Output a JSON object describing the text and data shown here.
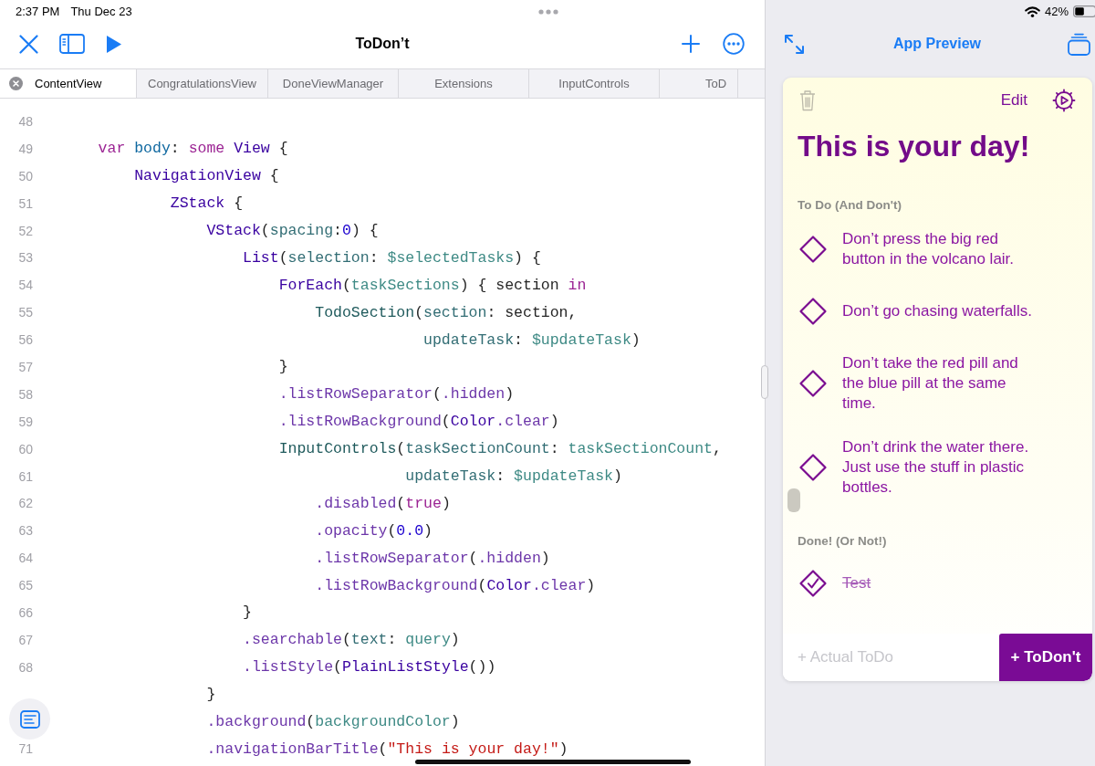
{
  "status_bar": {
    "time": "2:37 PM",
    "date": "Thu Dec 23",
    "battery": "42%"
  },
  "editor": {
    "title": "ToDon’t",
    "tabs": [
      {
        "label": "ContentView",
        "selected": true
      },
      {
        "label": "CongratulationsView",
        "selected": false
      },
      {
        "label": "DoneViewManager",
        "selected": false
      },
      {
        "label": "Extensions",
        "selected": false
      },
      {
        "label": "InputControls",
        "selected": false
      },
      {
        "label": "ToD",
        "selected": false
      }
    ],
    "code_lines": [
      {
        "number": "48"
      },
      {
        "number": "49",
        "tokens": [
          {
            "kind": "keyword",
            "text": "    var"
          },
          {
            "kind": "declaration",
            "text": " body"
          },
          {
            "kind": "plain",
            "text": ": "
          },
          {
            "kind": "keyword",
            "text": "some"
          },
          {
            "kind": "type",
            "text": " View"
          },
          {
            "kind": "plain",
            "text": " {"
          }
        ]
      },
      {
        "number": "50",
        "tokens": [
          {
            "kind": "type",
            "text": "        NavigationView"
          },
          {
            "kind": "plain",
            "text": " {"
          }
        ]
      },
      {
        "number": "51",
        "tokens": [
          {
            "kind": "type",
            "text": "            ZStack"
          },
          {
            "kind": "plain",
            "text": " {"
          }
        ]
      },
      {
        "number": "52",
        "tokens": [
          {
            "kind": "type",
            "text": "                VStack"
          },
          {
            "kind": "plain",
            "text": "("
          },
          {
            "kind": "label",
            "text": "spacing"
          },
          {
            "kind": "plain",
            "text": ":"
          },
          {
            "kind": "number",
            "text": "0"
          },
          {
            "kind": "plain",
            "text": ") {"
          }
        ]
      },
      {
        "number": "53",
        "tokens": [
          {
            "kind": "type",
            "text": "                    List"
          },
          {
            "kind": "plain",
            "text": "("
          },
          {
            "kind": "label",
            "text": "selection"
          },
          {
            "kind": "plain",
            "text": ": "
          },
          {
            "kind": "project",
            "text": "$selectedTasks"
          },
          {
            "kind": "plain",
            "text": ") {"
          }
        ]
      },
      {
        "number": "54",
        "tokens": [
          {
            "kind": "type",
            "text": "                        ForEach"
          },
          {
            "kind": "plain",
            "text": "("
          },
          {
            "kind": "project",
            "text": "taskSections"
          },
          {
            "kind": "plain",
            "text": ") { section "
          },
          {
            "kind": "keyword",
            "text": "in"
          }
        ]
      },
      {
        "number": "55",
        "tokens": [
          {
            "kind": "project_type",
            "text": "                            TodoSection"
          },
          {
            "kind": "plain",
            "text": "("
          },
          {
            "kind": "label",
            "text": "section"
          },
          {
            "kind": "plain",
            "text": ": section,"
          }
        ]
      },
      {
        "number": "56",
        "tokens": [
          {
            "kind": "label",
            "text": "                                        updateTask"
          },
          {
            "kind": "plain",
            "text": ": "
          },
          {
            "kind": "project",
            "text": "$updateTask"
          },
          {
            "kind": "plain",
            "text": ")"
          }
        ]
      },
      {
        "number": "57",
        "tokens": [
          {
            "kind": "plain",
            "text": "                        }"
          }
        ]
      },
      {
        "number": "58",
        "tokens": [
          {
            "kind": "method",
            "text": "                        .listRowSeparator"
          },
          {
            "kind": "plain",
            "text": "("
          },
          {
            "kind": "method",
            "text": ".hidden"
          },
          {
            "kind": "plain",
            "text": ")"
          }
        ]
      },
      {
        "number": "59",
        "tokens": [
          {
            "kind": "method",
            "text": "                        .listRowBackground"
          },
          {
            "kind": "plain",
            "text": "("
          },
          {
            "kind": "type",
            "text": "Color"
          },
          {
            "kind": "method",
            "text": ".clear"
          },
          {
            "kind": "plain",
            "text": ")"
          }
        ]
      },
      {
        "number": "60",
        "tokens": [
          {
            "kind": "project_type",
            "text": "                        InputControls"
          },
          {
            "kind": "plain",
            "text": "("
          },
          {
            "kind": "label",
            "text": "taskSectionCount"
          },
          {
            "kind": "plain",
            "text": ": "
          },
          {
            "kind": "project",
            "text": "taskSectionCount"
          },
          {
            "kind": "plain",
            "text": ","
          }
        ]
      },
      {
        "number": "61",
        "tokens": [
          {
            "kind": "label",
            "text": "                                      updateTask"
          },
          {
            "kind": "plain",
            "text": ": "
          },
          {
            "kind": "project",
            "text": "$updateTask"
          },
          {
            "kind": "plain",
            "text": ")"
          }
        ]
      },
      {
        "number": "62",
        "tokens": [
          {
            "kind": "method",
            "text": "                            .disabled"
          },
          {
            "kind": "plain",
            "text": "("
          },
          {
            "kind": "keyword",
            "text": "true"
          },
          {
            "kind": "plain",
            "text": ")"
          }
        ]
      },
      {
        "number": "63",
        "tokens": [
          {
            "kind": "method",
            "text": "                            .opacity"
          },
          {
            "kind": "plain",
            "text": "("
          },
          {
            "kind": "number",
            "text": "0.0"
          },
          {
            "kind": "plain",
            "text": ")"
          }
        ]
      },
      {
        "number": "64",
        "tokens": [
          {
            "kind": "method",
            "text": "                            .listRowSeparator"
          },
          {
            "kind": "plain",
            "text": "("
          },
          {
            "kind": "method",
            "text": ".hidden"
          },
          {
            "kind": "plain",
            "text": ")"
          }
        ]
      },
      {
        "number": "65",
        "tokens": [
          {
            "kind": "method",
            "text": "                            .listRowBackground"
          },
          {
            "kind": "plain",
            "text": "("
          },
          {
            "kind": "type",
            "text": "Color"
          },
          {
            "kind": "method",
            "text": ".clear"
          },
          {
            "kind": "plain",
            "text": ")"
          }
        ]
      },
      {
        "number": "66",
        "tokens": [
          {
            "kind": "plain",
            "text": "                    }"
          }
        ]
      },
      {
        "number": "67",
        "tokens": [
          {
            "kind": "method",
            "text": "                    .searchable"
          },
          {
            "kind": "plain",
            "text": "("
          },
          {
            "kind": "label",
            "text": "text"
          },
          {
            "kind": "plain",
            "text": ": "
          },
          {
            "kind": "project",
            "text": "query"
          },
          {
            "kind": "plain",
            "text": ")"
          }
        ]
      },
      {
        "number": "68",
        "tokens": [
          {
            "kind": "method",
            "text": "                    .listStyle"
          },
          {
            "kind": "plain",
            "text": "("
          },
          {
            "kind": "type",
            "text": "PlainListStyle"
          },
          {
            "kind": "plain",
            "text": "())"
          }
        ]
      },
      {
        "tokens": [
          {
            "kind": "plain",
            "text": "                }"
          }
        ]
      },
      {
        "tokens": [
          {
            "kind": "method",
            "text": "                .background"
          },
          {
            "kind": "plain",
            "text": "("
          },
          {
            "kind": "project",
            "text": "backgroundColor"
          },
          {
            "kind": "plain",
            "text": ")"
          }
        ]
      },
      {
        "number": "71",
        "tokens": [
          {
            "kind": "method",
            "text": "                .navigationBarTitle"
          },
          {
            "kind": "plain",
            "text": "("
          },
          {
            "kind": "string",
            "text": "\"This is your day!\""
          },
          {
            "kind": "plain",
            "text": ")"
          }
        ]
      }
    ]
  },
  "preview": {
    "title": "App Preview",
    "trash_disabled": true,
    "edit": "Edit",
    "heading": "This is your day!",
    "sections": [
      {
        "title": "To Do (And Don't)",
        "tasks": [
          {
            "text": "Don’t press the big red button in the volcano lair.",
            "done": false
          },
          {
            "text": "Don’t go chasing waterfalls.",
            "done": false
          },
          {
            "text": "Don’t take the red pill and the blue pill at the same time.",
            "done": false
          },
          {
            "text": "Don’t drink the water there. Just use the stuff in plastic bottles.",
            "done": false
          }
        ]
      },
      {
        "title": "Done! (Or Not!)",
        "tasks": [
          {
            "text": "Test",
            "done": true
          }
        ]
      }
    ],
    "new_task": {
      "placeholder": "+ Actual ToDo"
    },
    "add_button": "+ ToDon't"
  }
}
